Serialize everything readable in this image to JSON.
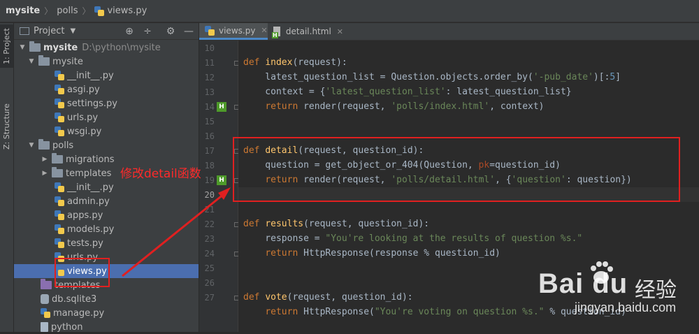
{
  "breadcrumb": [
    "mysite",
    "polls",
    "views.py"
  ],
  "tool_strip": {
    "project_tab": "1: Project",
    "structure_tab": "Z: Structure"
  },
  "project_panel": {
    "title": "Project",
    "tree": [
      {
        "label": "mysite",
        "sub": "D:\\python\\mysite"
      },
      {
        "label": "mysite"
      },
      {
        "label": "__init__.py"
      },
      {
        "label": "asgi.py"
      },
      {
        "label": "settings.py"
      },
      {
        "label": "urls.py"
      },
      {
        "label": "wsgi.py"
      },
      {
        "label": "polls"
      },
      {
        "label": "migrations"
      },
      {
        "label": "templates"
      },
      {
        "label": "__init__.py"
      },
      {
        "label": "admin.py"
      },
      {
        "label": "apps.py"
      },
      {
        "label": "models.py"
      },
      {
        "label": "tests.py"
      },
      {
        "label": "urls.py"
      },
      {
        "label": "views.py",
        "selected": true
      },
      {
        "label": "templates"
      },
      {
        "label": "db.sqlite3"
      },
      {
        "label": "manage.py"
      },
      {
        "label": "python"
      }
    ]
  },
  "tabs": [
    {
      "label": "views.py",
      "active": true
    },
    {
      "label": "detail.html",
      "active": false
    }
  ],
  "editor": {
    "current_line": 20,
    "lines": [
      {
        "n": "10"
      },
      {
        "n": "11"
      },
      {
        "n": "12"
      },
      {
        "n": "13"
      },
      {
        "n": "14"
      },
      {
        "n": "15"
      },
      {
        "n": "16"
      },
      {
        "n": "17"
      },
      {
        "n": "18"
      },
      {
        "n": "19"
      },
      {
        "n": "20"
      },
      {
        "n": "21"
      },
      {
        "n": "22"
      },
      {
        "n": "23"
      },
      {
        "n": "24"
      },
      {
        "n": "25"
      },
      {
        "n": "26"
      },
      {
        "n": "27"
      }
    ]
  },
  "annotation": {
    "text": "修改detail函数",
    "color": "#ff2a2a"
  },
  "watermark": {
    "brand": "Bai du",
    "cn": "经验",
    "url": "jingyan.baidu.com"
  },
  "colors": {
    "keyword": "#cc7832",
    "function": "#ffc66d",
    "string": "#6a8759",
    "selection": "#4b6eaf"
  }
}
